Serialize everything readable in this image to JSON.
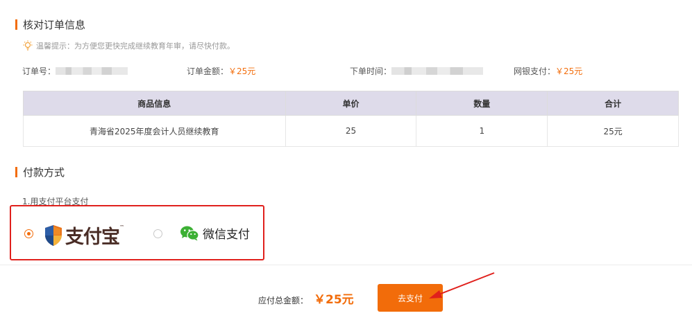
{
  "order_section": {
    "title": "核对订单信息",
    "tip": "温馨提示：为方便您更快完成继续教育年审，请尽快付款。",
    "order_no_label": "订单号：",
    "amount_label": "订单金额：",
    "amount_value": "￥25元",
    "time_label": "下单时间：",
    "netbank_label": "网银支付：",
    "netbank_value": "￥25元"
  },
  "table": {
    "headers": [
      "商品信息",
      "单价",
      "数量",
      "合计"
    ],
    "rows": [
      [
        "青海省2025年度会计人员继续教育",
        "25",
        "1",
        "25元"
      ]
    ]
  },
  "payment_section": {
    "title": "付款方式",
    "method_label": "1.用支付平台支付",
    "alipay_label": "支付宝",
    "wechat_label": "微信支付",
    "selected": "alipay"
  },
  "footer": {
    "total_label": "应付总金额：",
    "total_value": "￥25元",
    "pay_button": "去支付"
  },
  "colors": {
    "accent": "#f26c0a",
    "highlight_box": "#e0201c",
    "table_header_bg": "#dedbea",
    "wechat_green": "#3cb034"
  }
}
